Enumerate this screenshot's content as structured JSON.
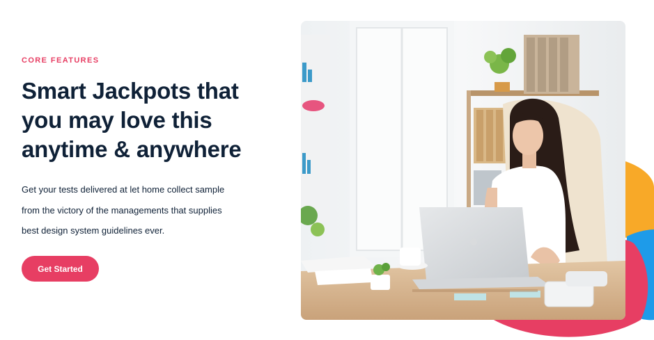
{
  "section": {
    "eyebrow": "CORE FEATURES",
    "title": "Smart Jackpots that\nyou may love this\nanytime & anywhere",
    "description": "Get your tests delivered at let home collect sample\nfrom the victory of the managements that supplies\nbest design system guidelines ever.",
    "cta_label": "Get Started"
  },
  "colors": {
    "accent": "#e73e63",
    "heading": "#0f2137",
    "blob_yellow": "#f8a928",
    "blob_blue": "#1e9be9",
    "blob_pink": "#e73e63"
  },
  "image": {
    "subject": "woman-working-at-laptop-in-office"
  }
}
